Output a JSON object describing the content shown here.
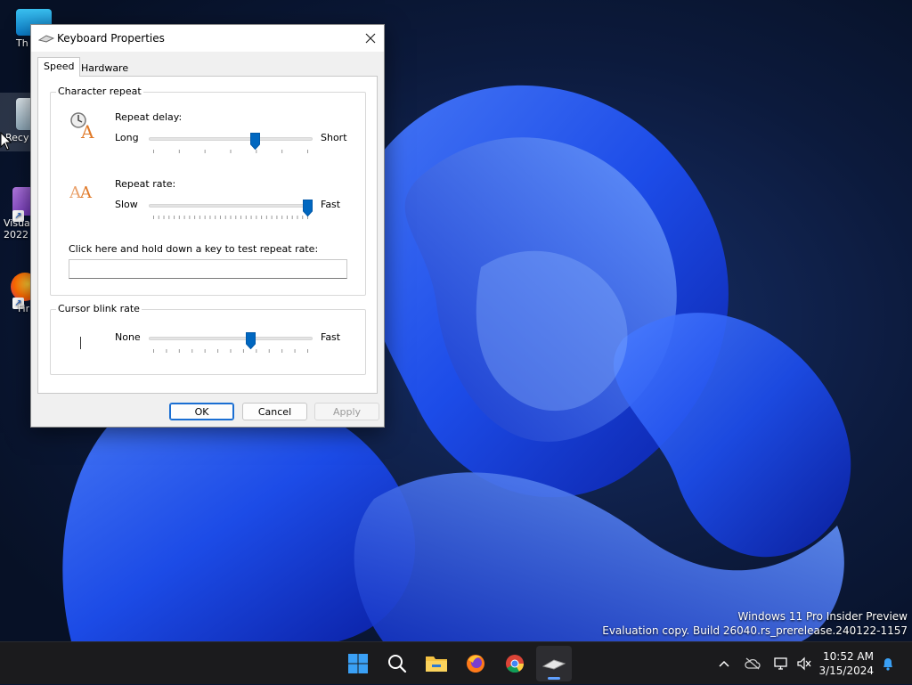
{
  "desktop": {
    "icons": [
      {
        "label": "Th"
      },
      {
        "label": "Recy"
      },
      {
        "label": "Visua 2022"
      },
      {
        "label": "Fir"
      }
    ],
    "watermark": {
      "line1": "Windows 11 Pro Insider Preview",
      "line2": "Evaluation copy. Build 26040.rs_prerelease.240122-1157"
    }
  },
  "dialog": {
    "title": "Keyboard Properties",
    "tabs": [
      {
        "label": "Speed",
        "selected": true
      },
      {
        "label": "Hardware",
        "selected": false
      }
    ],
    "character_repeat": {
      "group_title": "Character repeat",
      "repeat_delay": {
        "label": "Repeat delay:",
        "min_label": "Long",
        "max_label": "Short",
        "value": 0.66
      },
      "repeat_rate": {
        "label": "Repeat rate:",
        "min_label": "Slow",
        "max_label": "Fast",
        "value": 1.0
      },
      "test_label": "Click here and hold down a key to test repeat rate:",
      "test_value": ""
    },
    "cursor_blink": {
      "group_title": "Cursor blink rate",
      "min_label": "None",
      "max_label": "Fast",
      "value": 0.63
    },
    "buttons": {
      "ok": "OK",
      "cancel": "Cancel",
      "apply": "Apply"
    }
  },
  "taskbar": {
    "clock_time": "10:52 AM",
    "clock_date": "3/15/2024",
    "accent": "#0078d4"
  }
}
